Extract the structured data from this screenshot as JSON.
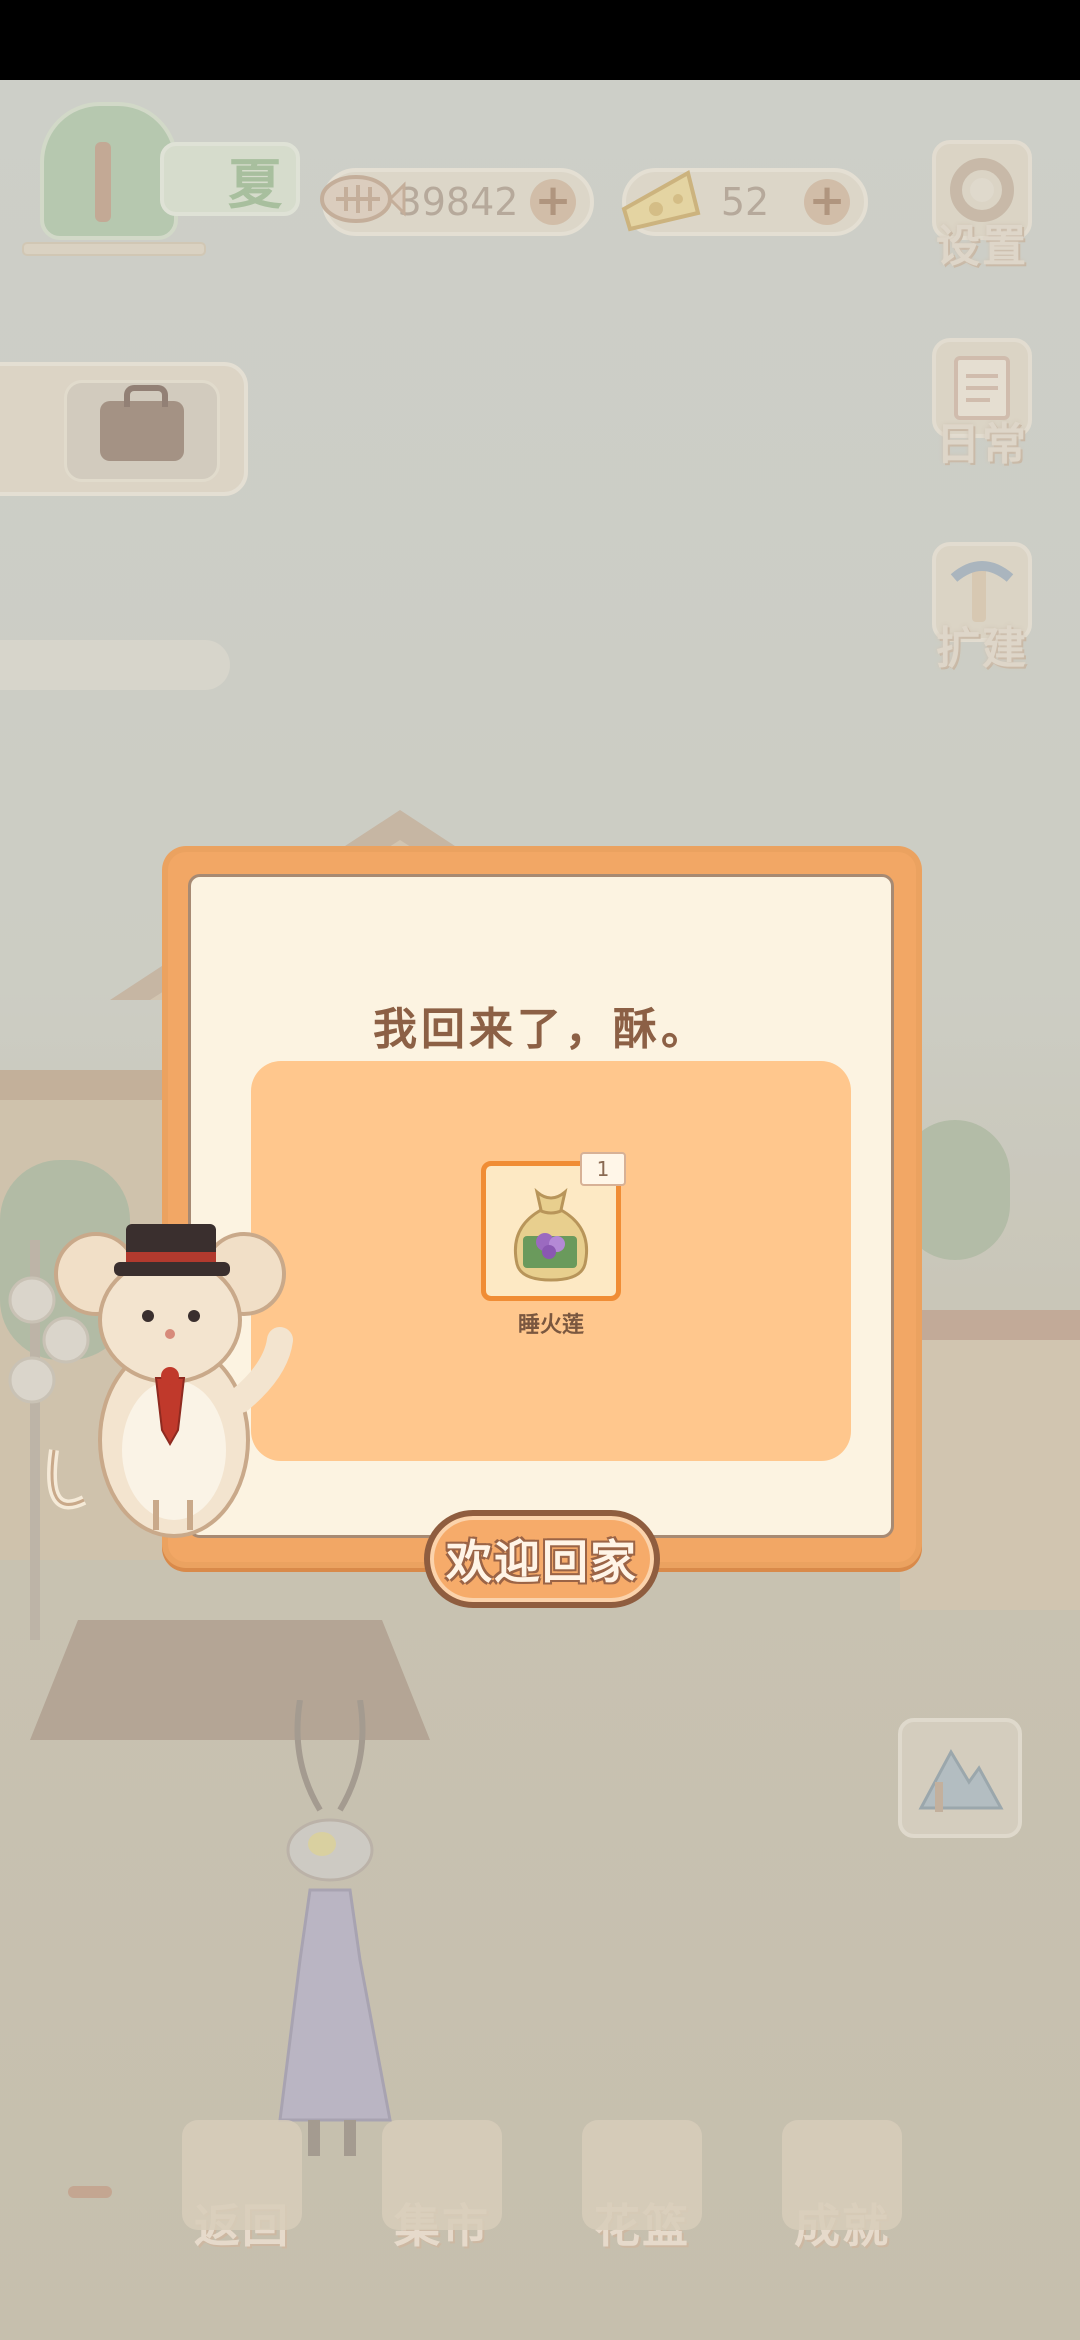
{
  "hud": {
    "season_label": "夏",
    "fish_currency": "39842",
    "cheese_currency": "52",
    "plus_symbol": "+"
  },
  "side_menu": {
    "settings_label": "设置",
    "daily_label": "日常",
    "expand_label": "扩建"
  },
  "dialog": {
    "message": "我回来了，酥。",
    "reward": {
      "name": "睡火莲",
      "count": "1",
      "icon": "seed-bag-icon"
    },
    "confirm_label": "欢迎回家"
  },
  "bottom_nav": {
    "items": [
      {
        "label": "返回",
        "icon": "door-icon"
      },
      {
        "label": "集市",
        "icon": "market-stall-icon"
      },
      {
        "label": "花篮",
        "icon": "flower-basket-icon"
      },
      {
        "label": "成就",
        "icon": "trophy-icon"
      }
    ]
  },
  "colors": {
    "dialog_frame": "#f2a765",
    "dialog_bg": "#fcf3e1",
    "reward_panel": "#ffc78d",
    "text_brown": "#8c6045"
  }
}
